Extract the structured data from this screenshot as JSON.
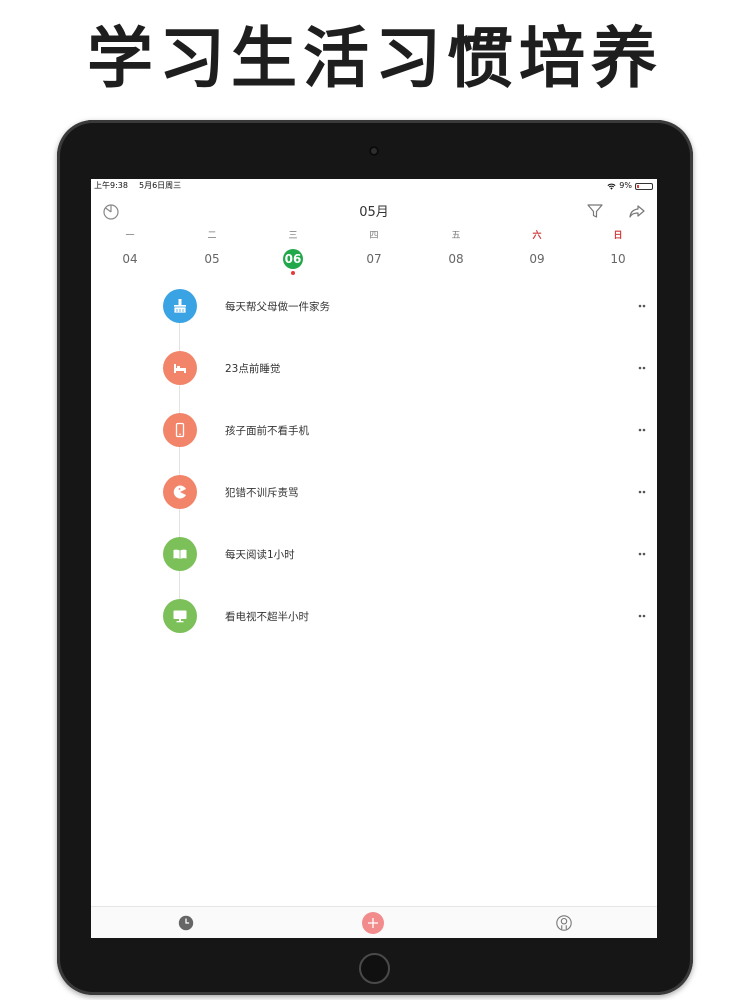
{
  "banner": {
    "title": "学习生活习惯培养"
  },
  "status_bar": {
    "time": "上午9:38",
    "date": "5月6日周三",
    "battery": "9%"
  },
  "nav": {
    "title": "05月"
  },
  "week": {
    "days": [
      {
        "weekday": "一",
        "date": "04"
      },
      {
        "weekday": "二",
        "date": "05"
      },
      {
        "weekday": "三",
        "date": "06"
      },
      {
        "weekday": "四",
        "date": "07"
      },
      {
        "weekday": "五",
        "date": "08"
      },
      {
        "weekday": "六",
        "date": "09"
      },
      {
        "weekday": "日",
        "date": "10"
      }
    ],
    "selected_date": "06"
  },
  "habits": [
    {
      "name": "每天帮父母做一件家务",
      "icon": "broom-icon",
      "color": "#3aa3e3"
    },
    {
      "name": "23点前睡觉",
      "icon": "bed-icon",
      "color": "#f2846a"
    },
    {
      "name": "孩子面前不看手机",
      "icon": "phone-icon",
      "color": "#f2846a"
    },
    {
      "name": "犯错不训斥责骂",
      "icon": "pacman-icon",
      "color": "#f2846a"
    },
    {
      "name": "每天阅读1小时",
      "icon": "book-icon",
      "color": "#7cc05a"
    },
    {
      "name": "看电视不超半小时",
      "icon": "tv-icon",
      "color": "#7cc05a"
    }
  ],
  "colors": {
    "selected": "#21a84a",
    "weekend": "#d23b3b",
    "add_button": "#f28b8b",
    "today_dot": "#e23c3c"
  }
}
